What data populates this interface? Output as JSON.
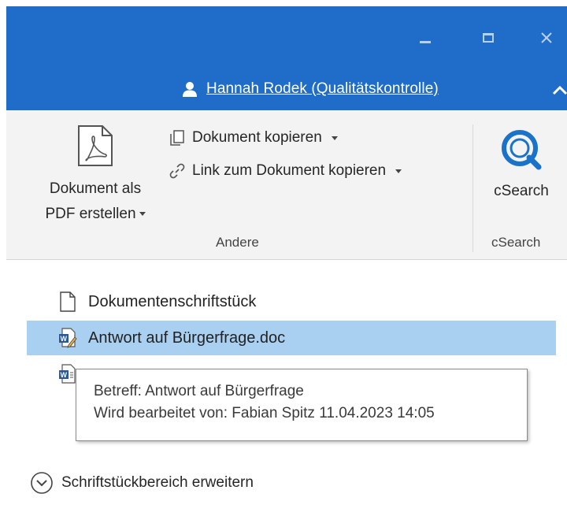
{
  "window": {
    "controls": {
      "minimize_icon": "minimize-icon",
      "maximize_icon": "maximize-icon",
      "close_icon": "close-icon"
    }
  },
  "user": {
    "name": "Hannah Rodek (Qualitätskontrolle)",
    "icon": "user-icon"
  },
  "ribbon": {
    "pdf_button": {
      "line1": "Dokument als",
      "line2": "PDF erstellen"
    },
    "copy_document": "Dokument kopieren",
    "copy_link": "Link zum Dokument kopieren",
    "group_andere": "Andere",
    "csearch_button": "cSearch",
    "group_csearch": "cSearch"
  },
  "list": {
    "items": [
      {
        "label": "Dokumentenschriftstück",
        "icon": "blank-document-icon"
      },
      {
        "label": "Antwort auf Bürgerfrage.doc",
        "icon": "word-edit-icon",
        "selected": true
      },
      {
        "label": "",
        "icon": "word-document-icon"
      }
    ]
  },
  "tooltip": {
    "line1": "Betreff: Antwort auf Bürgerfrage",
    "line2": "Wird bearbeitet von: Fabian Spitz 11.04.2023 14:05"
  },
  "expand": {
    "label": "Schriftstückbereich erweitern"
  },
  "colors": {
    "titlebar": "#1f6dc9",
    "selection": "#a9cff1",
    "csearch": "#1a73c8"
  }
}
